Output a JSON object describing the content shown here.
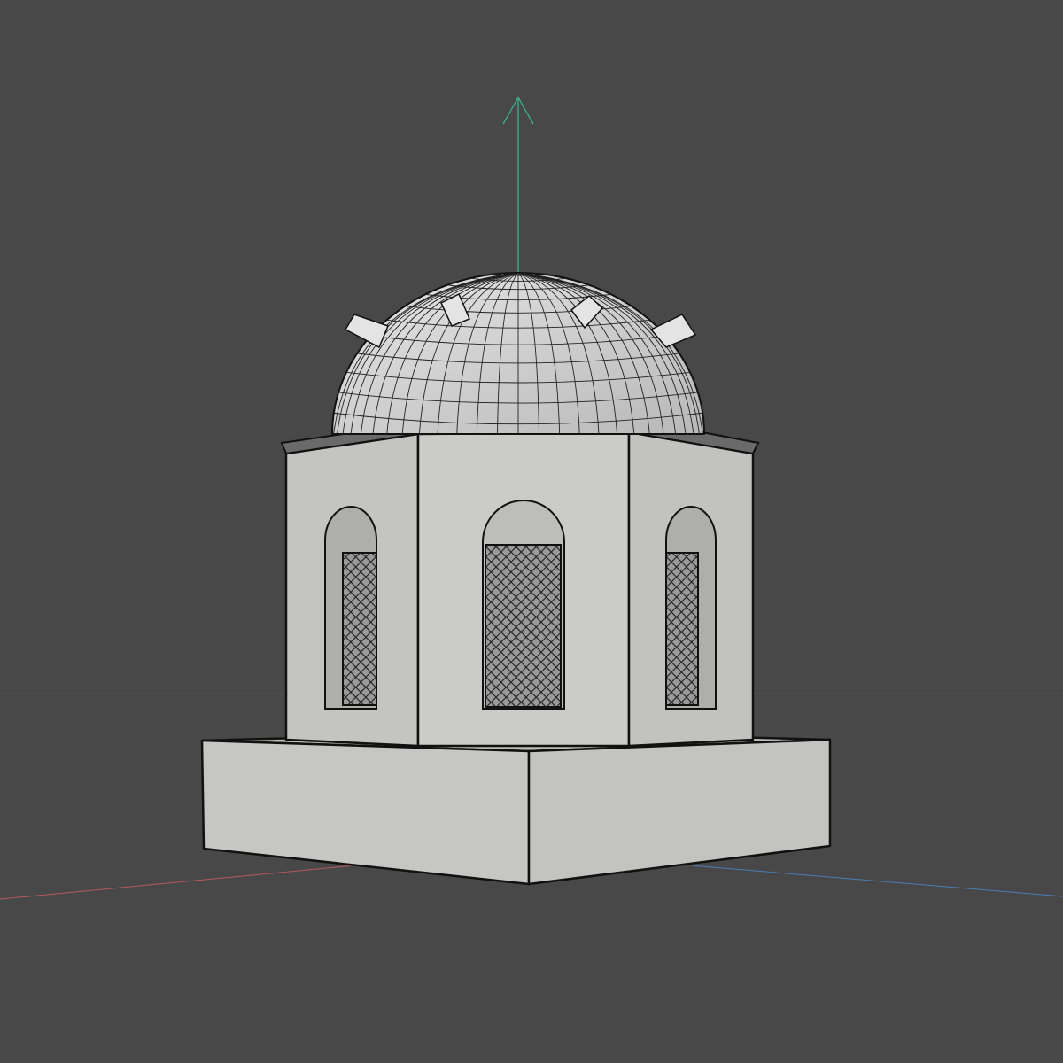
{
  "viewport": {
    "background_color": "#484848",
    "horizon_color": "#555555",
    "axes": {
      "x_color": "#b85a5a",
      "y_color": "#3fae8c",
      "z_color": "#4a7fb5"
    },
    "model": {
      "wall_color": "#c9c9c5",
      "shadow_wall_color": "#b9b9b5",
      "dome_color": "#d8d8d8",
      "edge_color": "#111111",
      "lattice_color": "#2a2a2a"
    },
    "icons": [
      "y-axis-arrow-icon"
    ]
  }
}
